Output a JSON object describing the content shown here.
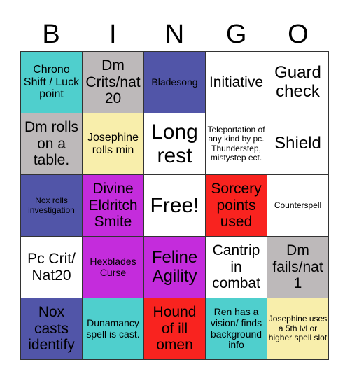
{
  "header": {
    "letters": [
      "B",
      "I",
      "N",
      "G",
      "O"
    ]
  },
  "colors": {
    "teal": "#4fcfcd",
    "gray": "#bdb9ba",
    "indigo": "#5155a8",
    "white": "#ffffff",
    "yellow": "#f8eeab",
    "purple": "#c42cdc",
    "red": "#f9231f"
  },
  "cells": [
    {
      "text": "Chrono Shift / Luck point",
      "color": "teal",
      "size": "s-md"
    },
    {
      "text": "Dm Crits/nat 20",
      "color": "gray",
      "size": "s-lg"
    },
    {
      "text": "Bladesong",
      "color": "indigo",
      "size": "s-sm"
    },
    {
      "text": "Initiative",
      "color": "white",
      "size": "s-lg"
    },
    {
      "text": "Guard check",
      "color": "white",
      "size": "s-xl"
    },
    {
      "text": "Dm rolls on a table.",
      "color": "gray",
      "size": "s-lg"
    },
    {
      "text": "Josephine rolls min",
      "color": "yellow",
      "size": "s-md"
    },
    {
      "text": "Long rest",
      "color": "white",
      "size": "s-xxl"
    },
    {
      "text": "Teleportation of any kind by pc. Thunderstep, mistystep ect.",
      "color": "white",
      "size": "s-xs"
    },
    {
      "text": "Shield",
      "color": "white",
      "size": "s-xl"
    },
    {
      "text": "Nox rolls investigation",
      "color": "indigo",
      "size": "s-xs"
    },
    {
      "text": "Divine Eldritch Smite",
      "color": "purple",
      "size": "s-lg"
    },
    {
      "text": "Free!",
      "color": "white",
      "size": "s-xxl"
    },
    {
      "text": "Sorcery points used",
      "color": "red",
      "size": "s-lg"
    },
    {
      "text": "Counterspell",
      "color": "white",
      "size": "s-xs"
    },
    {
      "text": "Pc Crit/ Nat20",
      "color": "white",
      "size": "s-lg"
    },
    {
      "text": "Hexblades Curse",
      "color": "purple",
      "size": "s-sm"
    },
    {
      "text": "Feline Agility",
      "color": "purple",
      "size": "s-xl"
    },
    {
      "text": "Cantrip in combat",
      "color": "white",
      "size": "s-lg"
    },
    {
      "text": "Dm fails/nat 1",
      "color": "gray",
      "size": "s-lg"
    },
    {
      "text": "Nox casts identify",
      "color": "indigo",
      "size": "s-lg"
    },
    {
      "text": "Dunamancy spell is cast.",
      "color": "teal",
      "size": "s-sm"
    },
    {
      "text": "Hound of ill omen",
      "color": "red",
      "size": "s-lg"
    },
    {
      "text": "Ren has a vision/ finds background info",
      "color": "teal",
      "size": "s-sm"
    },
    {
      "text": "Josephine uses a 5th lvl or higher spell slot",
      "color": "yellow",
      "size": "s-xs"
    }
  ]
}
